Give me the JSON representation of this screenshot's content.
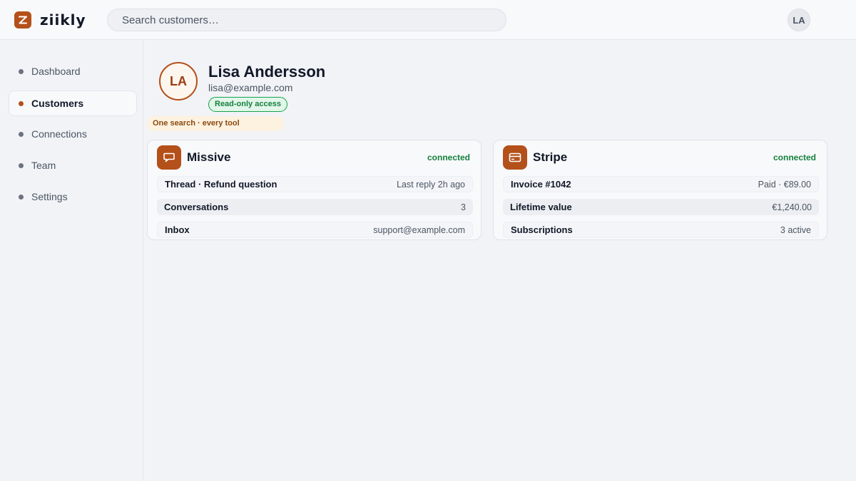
{
  "app": {
    "name": "ziikly"
  },
  "search": {
    "placeholder": "Search customers…"
  },
  "user": {
    "initials": "LA"
  },
  "sidebar": {
    "items": [
      {
        "label": "Dashboard",
        "active": false
      },
      {
        "label": "Customers",
        "active": true
      },
      {
        "label": "Connections",
        "active": false
      },
      {
        "label": "Team",
        "active": false
      },
      {
        "label": "Settings",
        "active": false
      }
    ]
  },
  "customer": {
    "initials": "LA",
    "name": "Lisa Andersson",
    "email": "lisa@example.com",
    "badge": "Read-only access",
    "tagline": "One search · every tool"
  },
  "cards": [
    {
      "title": "Missive",
      "icon": "chat-bubble-icon",
      "status": "connected",
      "rows": [
        {
          "label": "Thread · Refund question",
          "value": "Last reply 2h ago"
        },
        {
          "label": "Conversations",
          "value": "3"
        },
        {
          "label": "Inbox",
          "value": "support@example.com"
        }
      ]
    },
    {
      "title": "Stripe",
      "icon": "credit-card-icon",
      "status": "connected",
      "rows": [
        {
          "label": "Invoice #1042",
          "value": "Paid · €89.00"
        },
        {
          "label": "Lifetime value",
          "value": "€1,240.00"
        },
        {
          "label": "Subscriptions",
          "value": "3 active"
        }
      ]
    }
  ],
  "colors": {
    "accent": "#b4501a",
    "success": "#15803d",
    "background": "#f1f3f7"
  }
}
